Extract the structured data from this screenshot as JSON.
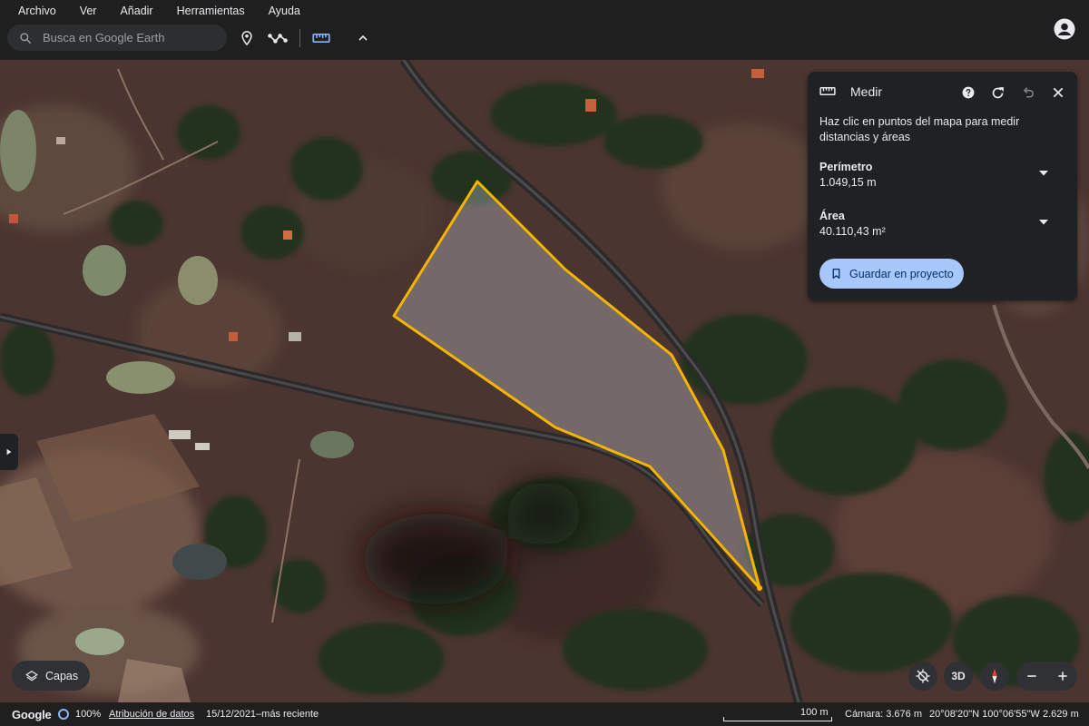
{
  "menu": {
    "items": [
      "Archivo",
      "Ver",
      "Añadir",
      "Herramientas",
      "Ayuda"
    ]
  },
  "search": {
    "placeholder": "Busca en Google Earth"
  },
  "toolbar": {
    "icons": [
      "search-icon",
      "placemark-icon",
      "path-icon",
      "ruler-icon",
      "chevron-up-icon",
      "account-icon"
    ]
  },
  "measure_panel": {
    "title": "Medir",
    "description": "Haz clic en puntos del mapa para medir distancias y áreas",
    "perimeter_label": "Perímetro",
    "perimeter_value": "1.049,15 m",
    "area_label": "Área",
    "area_value": "40.110,43 m²",
    "save_label": "Guardar en proyecto",
    "icons": [
      "ruler-icon",
      "help-icon",
      "redo-icon",
      "undo-icon",
      "close-icon",
      "chevron-down-icon",
      "bookmark-icon"
    ]
  },
  "map_controls": {
    "layers_label": "Capas",
    "three_d_label": "3D",
    "zoom_out": "−",
    "zoom_in": "+",
    "icons": [
      "layers-icon",
      "no-location-icon",
      "compass-icon"
    ]
  },
  "status": {
    "brand": "Google",
    "zoom_percent": "100%",
    "attribution": "Atribución de datos",
    "date": "15/12/2021–más reciente",
    "scale": "100 m",
    "camera": "Cámara: 3.676 m",
    "coords": "20°08'20\"N 100°06'55\"W",
    "elevation": "2.629 m"
  },
  "colors": {
    "polygon_stroke": "#f4b400",
    "panel_bg": "#202124",
    "topbar_bg": "#1f1f1f",
    "button_accent": "#a8c7fa"
  }
}
